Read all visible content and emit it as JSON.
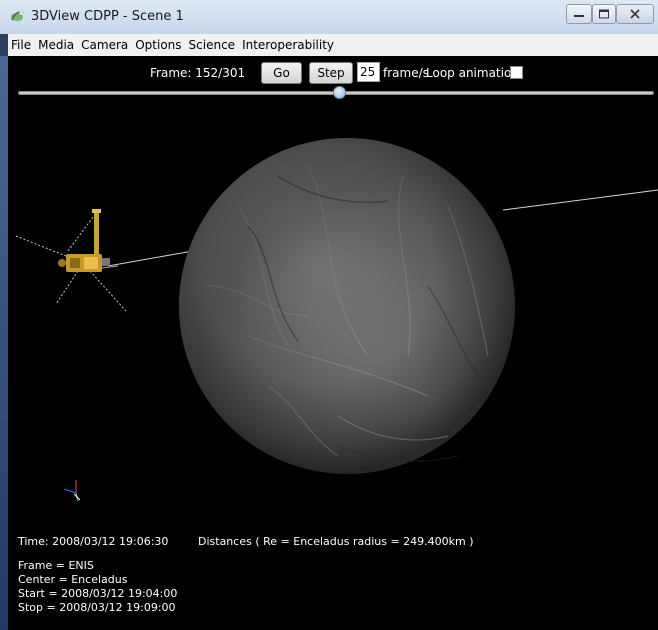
{
  "window": {
    "title": "3DView CDPP - Scene 1"
  },
  "menu": {
    "items": [
      "File",
      "Media",
      "Camera",
      "Options",
      "Science",
      "Interoperability"
    ]
  },
  "controls": {
    "frame_label": "Frame: 152/301",
    "go_label": "Go",
    "step_label": "Step",
    "fps_value": "25",
    "fps_unit": "frame/s",
    "loop_label": "Loop animation",
    "loop_checked": false,
    "slider": {
      "value": 152,
      "max": 301
    }
  },
  "scene": {
    "time_text": "Time: 2008/03/12 19:06:30",
    "distances_text": "Distances ( Re = Enceladus radius = 249.400km )",
    "info_lines": [
      "Frame = ENIS",
      "Center = Enceladus",
      "Start = 2008/03/12 19:04:00",
      "Stop = 2008/03/12 19:09:00"
    ],
    "icons": [
      "spacecraft-icon",
      "axis-triad-icon",
      "moon-globe"
    ]
  }
}
